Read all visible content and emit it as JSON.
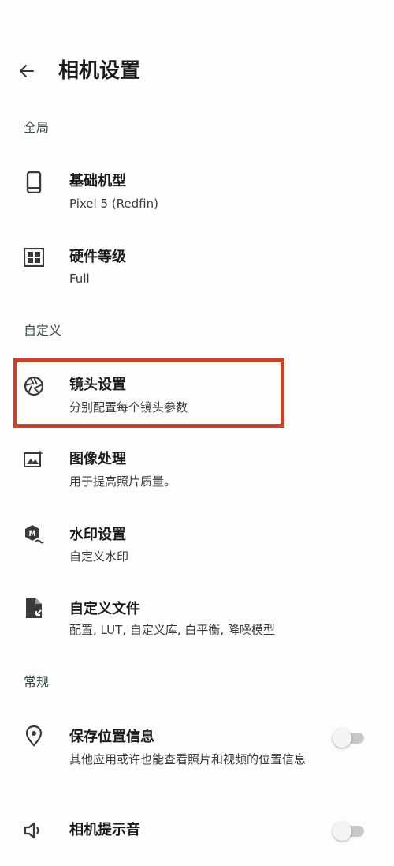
{
  "header": {
    "title": "相机设置"
  },
  "sections": {
    "global": "全局",
    "custom": "自定义",
    "general": "常规"
  },
  "items": {
    "base_model": {
      "title": "基础机型",
      "subtitle": "Pixel 5 (Redfin)",
      "icon": "phone-icon"
    },
    "hardware_level": {
      "title": "硬件等级",
      "subtitle": "Full",
      "icon": "chip-icon"
    },
    "lens_settings": {
      "title": "镜头设置",
      "subtitle": "分别配置每个镜头参数",
      "icon": "aperture-icon"
    },
    "image_processing": {
      "title": "图像处理",
      "subtitle": "用于提高照片质量。",
      "icon": "image-enhance-icon"
    },
    "watermark": {
      "title": "水印设置",
      "subtitle": "自定义水印",
      "icon": "watermark-icon"
    },
    "custom_files": {
      "title": "自定义文件",
      "subtitle": "配置, LUT, 自定义库, 白平衡, 降噪模型",
      "icon": "file-import-icon"
    },
    "save_location": {
      "title": "保存位置信息",
      "subtitle": "其他应用或许也能查看照片和视频的位置信息",
      "icon": "location-pin-icon",
      "enabled": false
    },
    "shutter_sound": {
      "title": "相机提示音",
      "icon": "speaker-icon",
      "enabled": false
    }
  },
  "colors": {
    "highlight_border": "#c4442b",
    "toggle_off_track": "#c8c8c8"
  }
}
